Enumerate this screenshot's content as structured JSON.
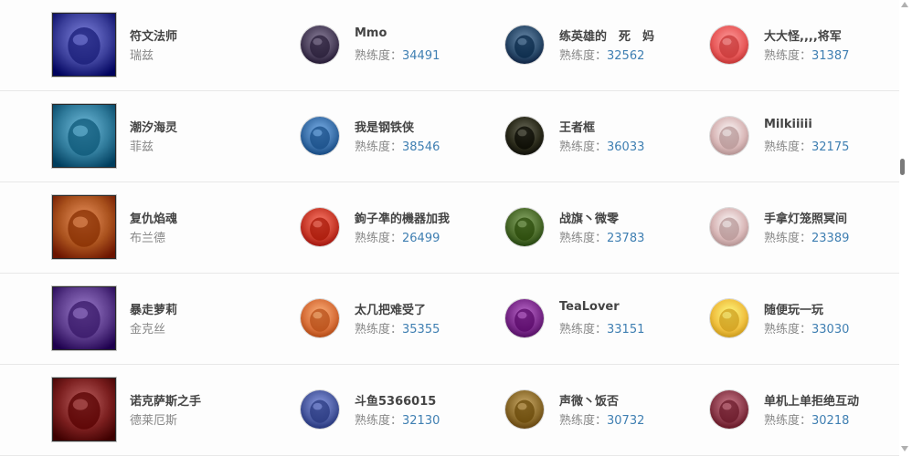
{
  "score_label": "熟练度：",
  "rows": [
    {
      "champion": {
        "title": "符文法师",
        "name": "瑞兹",
        "icon": "ryze-portrait",
        "color": "#3b3f9a"
      },
      "players": [
        {
          "name": "Mmo",
          "score": "34491",
          "avatar": "dark-haired-avatar",
          "color": "#4a3f5a"
        },
        {
          "name": "练英雄的　死　妈",
          "score": "32562",
          "avatar": "blue-haired-avatar",
          "color": "#2a4a6a"
        },
        {
          "name": "大大怪,,,,将军",
          "score": "31387",
          "avatar": "penguin-avatar",
          "color": "#e85a5a"
        }
      ]
    },
    {
      "champion": {
        "title": "潮汐海灵",
        "name": "菲兹",
        "icon": "fizz-portrait",
        "color": "#2f7a9a"
      },
      "players": [
        {
          "name": "我是钢铁侠",
          "score": "38546",
          "avatar": "chibi-girl-avatar",
          "color": "#3a6fa8"
        },
        {
          "name": "王者框",
          "score": "36033",
          "avatar": "gold-emblem-avatar",
          "color": "#2a2a1a"
        },
        {
          "name": "Milkiiiii",
          "score": "32175",
          "avatar": "poro-avatar",
          "color": "#d9b8b8"
        }
      ]
    },
    {
      "champion": {
        "title": "复仇焰魂",
        "name": "布兰德",
        "icon": "brand-portrait",
        "color": "#a8501c"
      },
      "players": [
        {
          "name": "鉤子凖的機器加我",
          "score": "26499",
          "avatar": "pirate-avatar",
          "color": "#c83a2a"
        },
        {
          "name": "战旗丶微零",
          "score": "23783",
          "avatar": "green-goblin-avatar",
          "color": "#4a6a2a"
        },
        {
          "name": "手拿灯笼照冥间",
          "score": "23389",
          "avatar": "poro-avatar",
          "color": "#d9b8b8"
        }
      ]
    },
    {
      "champion": {
        "title": "暴走萝莉",
        "name": "金克丝",
        "icon": "jinx-portrait",
        "color": "#5a3a8a"
      },
      "players": [
        {
          "name": "太几把难受了",
          "score": "35355",
          "avatar": "orange-girl-avatar",
          "color": "#d8703a"
        },
        {
          "name": "TeaLover",
          "score": "33151",
          "avatar": "pumpkin-avatar",
          "color": "#7a2a8a"
        },
        {
          "name": "随便玩一玩",
          "score": "33030",
          "avatar": "crowned-poro-avatar",
          "color": "#f0c040"
        }
      ]
    },
    {
      "champion": {
        "title": "诺克萨斯之手",
        "name": "德莱厄斯",
        "icon": "darius-portrait",
        "color": "#7a1e1e"
      },
      "players": [
        {
          "name": "斗鱼5366015",
          "score": "32130",
          "avatar": "blue-beast-avatar",
          "color": "#4a5aa0"
        },
        {
          "name": "声微丶饭否",
          "score": "30732",
          "avatar": "fox-avatar",
          "color": "#8a6a2a"
        },
        {
          "name": "单机上单拒绝互动",
          "score": "30218",
          "avatar": "white-haired-avatar",
          "color": "#8a3a4a"
        }
      ]
    }
  ]
}
